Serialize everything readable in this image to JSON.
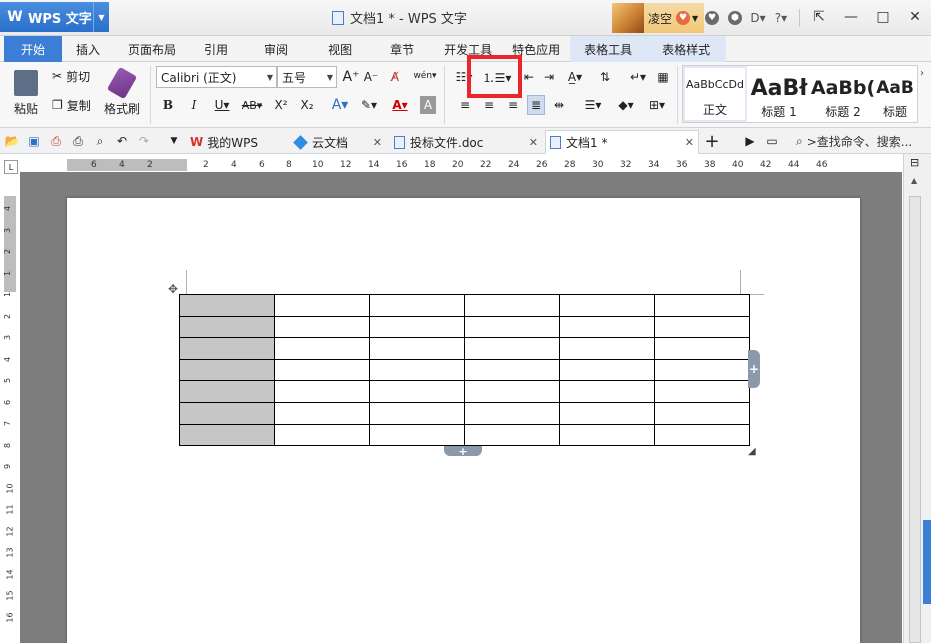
{
  "app": {
    "name": "WPS 文字",
    "logo": "W"
  },
  "window": {
    "doc_title": "文档1 * - WPS 文字"
  },
  "user": {
    "name": "凌空",
    "badge": "♥"
  },
  "ribbon_tabs": [
    "开始",
    "插入",
    "页面布局",
    "引用",
    "审阅",
    "视图",
    "章节",
    "开发工具",
    "特色应用",
    "表格工具",
    "表格样式"
  ],
  "clipboard": {
    "paste": "粘贴",
    "cut": "剪切",
    "copy": "复制",
    "format_painter": "格式刷"
  },
  "font": {
    "name": "Calibri (正文)",
    "size": "五号"
  },
  "styles": [
    {
      "sample": "AaBbCcDd",
      "label": "正文"
    },
    {
      "sample": "AaBł",
      "label": "标题 1"
    },
    {
      "sample": "AaBb(",
      "label": "标题 2"
    },
    {
      "sample": "AaB",
      "label": "标题"
    }
  ],
  "doc_tabs": [
    {
      "label": "我的WPS"
    },
    {
      "label": "云文档"
    },
    {
      "label": "投标文件.doc"
    },
    {
      "label": "文档1 *"
    }
  ],
  "search_cmd": ">查找命令、搜索...",
  "ruler_numbers": [
    "6",
    "4",
    "2",
    "2",
    "4",
    "6",
    "8",
    "10",
    "12",
    "14",
    "16",
    "18",
    "20",
    "22",
    "24",
    "26",
    "28",
    "30",
    "32",
    "34",
    "36",
    "38",
    "40",
    "42",
    "44",
    "46"
  ],
  "vruler_numbers": [
    "4",
    "3",
    "2",
    "1",
    "1",
    "2",
    "3",
    "4",
    "5",
    "6",
    "7",
    "8",
    "9",
    "10",
    "11",
    "12",
    "13",
    "14",
    "15",
    "16"
  ],
  "table": {
    "rows": 7,
    "cols": 6
  }
}
